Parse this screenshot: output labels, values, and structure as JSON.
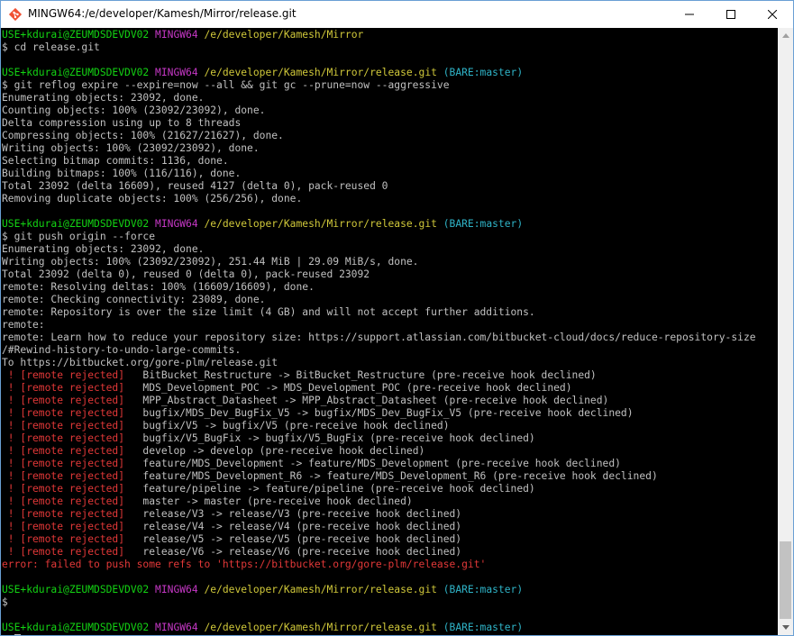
{
  "window": {
    "title": "MINGW64:/e/developer/Kamesh/Mirror/release.git",
    "icon": "git-bash-icon",
    "controls": [
      "minimize-icon",
      "maximize-icon",
      "close-icon"
    ]
  },
  "colors": {
    "user": "#13d413",
    "env": "#c638c6",
    "path": "#d0c83a",
    "branch": "#2fb4c8",
    "error": "#e23838",
    "text": "#c0c0c0",
    "background": "#000000"
  },
  "terminal": {
    "lines": [
      [
        {
          "t": "USE+kdurai@ZEUMDSDEVDV02",
          "c": "g"
        },
        {
          "t": " ",
          "c": "w"
        },
        {
          "t": "MINGW64",
          "c": "m"
        },
        {
          "t": " ",
          "c": "w"
        },
        {
          "t": "/e/developer/Kamesh/Mirror",
          "c": "y"
        }
      ],
      [
        {
          "t": "$ cd release.git",
          "c": "w"
        }
      ],
      [
        {
          "t": "",
          "c": "w"
        }
      ],
      [
        {
          "t": "USE+kdurai@ZEUMDSDEVDV02",
          "c": "g"
        },
        {
          "t": " ",
          "c": "w"
        },
        {
          "t": "MINGW64",
          "c": "m"
        },
        {
          "t": " ",
          "c": "w"
        },
        {
          "t": "/e/developer/Kamesh/Mirror/release.git",
          "c": "y"
        },
        {
          "t": " (BARE:master)",
          "c": "c"
        }
      ],
      [
        {
          "t": "$ git reflog expire --expire=now --all && git gc --prune=now --aggressive",
          "c": "w"
        }
      ],
      [
        {
          "t": "Enumerating objects: 23092, done.",
          "c": "w"
        }
      ],
      [
        {
          "t": "Counting objects: 100% (23092/23092), done.",
          "c": "w"
        }
      ],
      [
        {
          "t": "Delta compression using up to 8 threads",
          "c": "w"
        }
      ],
      [
        {
          "t": "Compressing objects: 100% (21627/21627), done.",
          "c": "w"
        }
      ],
      [
        {
          "t": "Writing objects: 100% (23092/23092), done.",
          "c": "w"
        }
      ],
      [
        {
          "t": "Selecting bitmap commits: 1136, done.",
          "c": "w"
        }
      ],
      [
        {
          "t": "Building bitmaps: 100% (116/116), done.",
          "c": "w"
        }
      ],
      [
        {
          "t": "Total 23092 (delta 16609), reused 4127 (delta 0), pack-reused 0",
          "c": "w"
        }
      ],
      [
        {
          "t": "Removing duplicate objects: 100% (256/256), done.",
          "c": "w"
        }
      ],
      [
        {
          "t": "",
          "c": "w"
        }
      ],
      [
        {
          "t": "USE+kdurai@ZEUMDSDEVDV02",
          "c": "g"
        },
        {
          "t": " ",
          "c": "w"
        },
        {
          "t": "MINGW64",
          "c": "m"
        },
        {
          "t": " ",
          "c": "w"
        },
        {
          "t": "/e/developer/Kamesh/Mirror/release.git",
          "c": "y"
        },
        {
          "t": " (BARE:master)",
          "c": "c"
        }
      ],
      [
        {
          "t": "$ git push origin --force",
          "c": "w"
        }
      ],
      [
        {
          "t": "Enumerating objects: 23092, done.",
          "c": "w"
        }
      ],
      [
        {
          "t": "Writing objects: 100% (23092/23092), 251.44 MiB | 29.09 MiB/s, done.",
          "c": "w"
        }
      ],
      [
        {
          "t": "Total 23092 (delta 0), reused 0 (delta 0), pack-reused 23092",
          "c": "w"
        }
      ],
      [
        {
          "t": "remote: Resolving deltas: 100% (16609/16609), done.",
          "c": "w"
        }
      ],
      [
        {
          "t": "remote: Checking connectivity: 23089, done.",
          "c": "w"
        }
      ],
      [
        {
          "t": "remote: Repository is over the size limit (4 GB) and will not accept further additions.",
          "c": "w"
        }
      ],
      [
        {
          "t": "remote:",
          "c": "w"
        }
      ],
      [
        {
          "t": "remote: Learn how to reduce your repository size: https://support.atlassian.com/bitbucket-cloud/docs/reduce-repository-size",
          "c": "w"
        }
      ],
      [
        {
          "t": "/#Rewind-history-to-undo-large-commits.",
          "c": "w"
        }
      ],
      [
        {
          "t": "To https://bitbucket.org/gore-plm/release.git",
          "c": "w"
        }
      ],
      [
        {
          "t": " ! [remote rejected]",
          "c": "r"
        },
        {
          "t": "   BitBucket_Restructure -> BitBucket_Restructure (pre-receive hook declined)",
          "c": "w"
        }
      ],
      [
        {
          "t": " ! [remote rejected]",
          "c": "r"
        },
        {
          "t": "   MDS_Development_POC -> MDS_Development_POC (pre-receive hook declined)",
          "c": "w"
        }
      ],
      [
        {
          "t": " ! [remote rejected]",
          "c": "r"
        },
        {
          "t": "   MPP_Abstract_Datasheet -> MPP_Abstract_Datasheet (pre-receive hook declined)",
          "c": "w"
        }
      ],
      [
        {
          "t": " ! [remote rejected]",
          "c": "r"
        },
        {
          "t": "   bugfix/MDS_Dev_BugFix_V5 -> bugfix/MDS_Dev_BugFix_V5 (pre-receive hook declined)",
          "c": "w"
        }
      ],
      [
        {
          "t": " ! [remote rejected]",
          "c": "r"
        },
        {
          "t": "   bugfix/V5 -> bugfix/V5 (pre-receive hook declined)",
          "c": "w"
        }
      ],
      [
        {
          "t": " ! [remote rejected]",
          "c": "r"
        },
        {
          "t": "   bugfix/V5_BugFix -> bugfix/V5_BugFix (pre-receive hook declined)",
          "c": "w"
        }
      ],
      [
        {
          "t": " ! [remote rejected]",
          "c": "r"
        },
        {
          "t": "   develop -> develop (pre-receive hook declined)",
          "c": "w"
        }
      ],
      [
        {
          "t": " ! [remote rejected]",
          "c": "r"
        },
        {
          "t": "   feature/MDS_Development -> feature/MDS_Development (pre-receive hook declined)",
          "c": "w"
        }
      ],
      [
        {
          "t": " ! [remote rejected]",
          "c": "r"
        },
        {
          "t": "   feature/MDS_Development_R6 -> feature/MDS_Development_R6 (pre-receive hook declined)",
          "c": "w"
        }
      ],
      [
        {
          "t": " ! [remote rejected]",
          "c": "r"
        },
        {
          "t": "   feature/pipeline -> feature/pipeline (pre-receive hook declined)",
          "c": "w"
        }
      ],
      [
        {
          "t": " ! [remote rejected]",
          "c": "r"
        },
        {
          "t": "   master -> master (pre-receive hook declined)",
          "c": "w"
        }
      ],
      [
        {
          "t": " ! [remote rejected]",
          "c": "r"
        },
        {
          "t": "   release/V3 -> release/V3 (pre-receive hook declined)",
          "c": "w"
        }
      ],
      [
        {
          "t": " ! [remote rejected]",
          "c": "r"
        },
        {
          "t": "   release/V4 -> release/V4 (pre-receive hook declined)",
          "c": "w"
        }
      ],
      [
        {
          "t": " ! [remote rejected]",
          "c": "r"
        },
        {
          "t": "   release/V5 -> release/V5 (pre-receive hook declined)",
          "c": "w"
        }
      ],
      [
        {
          "t": " ! [remote rejected]",
          "c": "r"
        },
        {
          "t": "   release/V6 -> release/V6 (pre-receive hook declined)",
          "c": "w"
        }
      ],
      [
        {
          "t": "error: failed to push some refs to 'https://bitbucket.org/gore-plm/release.git'",
          "c": "r"
        }
      ],
      [
        {
          "t": "",
          "c": "w"
        }
      ],
      [
        {
          "t": "USE+kdurai@ZEUMDSDEVDV02",
          "c": "g"
        },
        {
          "t": " ",
          "c": "w"
        },
        {
          "t": "MINGW64",
          "c": "m"
        },
        {
          "t": " ",
          "c": "w"
        },
        {
          "t": "/e/developer/Kamesh/Mirror/release.git",
          "c": "y"
        },
        {
          "t": " (BARE:master)",
          "c": "c"
        }
      ],
      [
        {
          "t": "$",
          "c": "w"
        }
      ],
      [
        {
          "t": "",
          "c": "w"
        }
      ],
      [
        {
          "t": "USE+kdurai@ZEUMDSDEVDV02",
          "c": "g"
        },
        {
          "t": " ",
          "c": "w"
        },
        {
          "t": "MINGW64",
          "c": "m"
        },
        {
          "t": " ",
          "c": "w"
        },
        {
          "t": "/e/developer/Kamesh/Mirror/release.git",
          "c": "y"
        },
        {
          "t": " (BARE:master)",
          "c": "c"
        }
      ],
      [
        {
          "t": "$ ",
          "c": "w"
        }
      ]
    ]
  }
}
